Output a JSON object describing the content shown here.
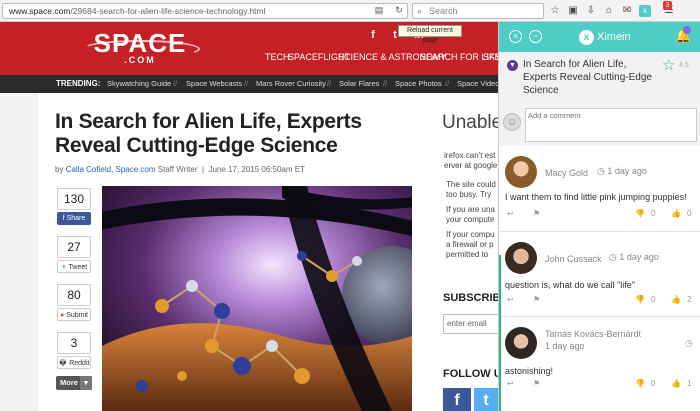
{
  "browser": {
    "url_host": "www.space.com",
    "url_path": "/29684-search-for-alien-life-science-technology.html",
    "search_placeholder": "Search",
    "tooltip": "Reload current page",
    "notification_count": "3"
  },
  "site": {
    "logo_text": "SPACE",
    "logo_sub": ".COM",
    "nav": [
      "TECH",
      "SPACEFLIGHT",
      "SCIENCE & ASTRONOMY",
      "SEARCH FOR LIFE",
      "SKY"
    ],
    "trending_label": "TRENDING:",
    "trending": [
      "Skywatching Guide",
      "Space Webcasts",
      "Mars Rover Curiosity",
      "Solar Flares",
      "Space Photos",
      "Space Video"
    ]
  },
  "article": {
    "headline": "In Search for Alien Life, Experts Reveal Cutting-Edge Science",
    "byline_prefix": "by",
    "author": "Calla Cofield",
    "outlet": "Space.com",
    "role": "Staff Writer",
    "separator": "|",
    "date": "June 17, 2015 06:50am ET"
  },
  "share": {
    "facebook": {
      "count": "130",
      "label": "Share"
    },
    "twitter": {
      "count": "27",
      "label": "Tweet"
    },
    "stumble": {
      "count": "80",
      "label": "Submit"
    },
    "reddit": {
      "count": "3",
      "label": "Reddit"
    },
    "more_label": "More"
  },
  "sidebar": {
    "unable_heading": "Unable",
    "lines": [
      "irefox can't est",
      "erver at google",
      "The site could",
      "too busy. Try",
      "If you are una",
      "your compute",
      "If your compu",
      "a firewall or p",
      "permitted to"
    ],
    "subscribe_heading": "SUBSCRIBE",
    "email_placeholder": "enter email",
    "follow_heading": "FOLLOW US"
  },
  "ximein": {
    "brand": "Ximein",
    "topic_title": "In Search for Alien Life, Experts Reveal Cutting-Edge Science",
    "rating": "4.5",
    "comment_placeholder": "Add a comment",
    "comments": [
      {
        "name": "Macy Gold",
        "time": "1 day ago",
        "text": "I want them to find little pink jumping puppies!",
        "dislikes": "0",
        "likes": "0"
      },
      {
        "name": "John Cussack",
        "time": "1 day ago",
        "text": "question is, what do we call \"life\"",
        "dislikes": "0",
        "likes": "2"
      },
      {
        "name": "Tamás Kovács-Bernárdt",
        "time": "1 day ago",
        "text": "astonishing!",
        "dislikes": "0",
        "likes": "1"
      }
    ]
  },
  "colors": {
    "space_red": "#c42026",
    "ximein_teal": "#4ecdc4",
    "facebook": "#3b5998",
    "twitter": "#55acee"
  },
  "icons": [
    "reader-view-icon",
    "reload-icon",
    "search-icon",
    "star-icon",
    "clipboard-icon",
    "download-icon",
    "home-icon",
    "chat-icon",
    "ximein-icon",
    "menu-icon",
    "facebook-icon",
    "twitter-icon",
    "linkedin-icon",
    "close-icon",
    "minimize-icon",
    "bell-icon",
    "chevron-down-icon",
    "clock-icon",
    "reply-icon",
    "flag-icon",
    "dislike-icon",
    "like-icon"
  ]
}
